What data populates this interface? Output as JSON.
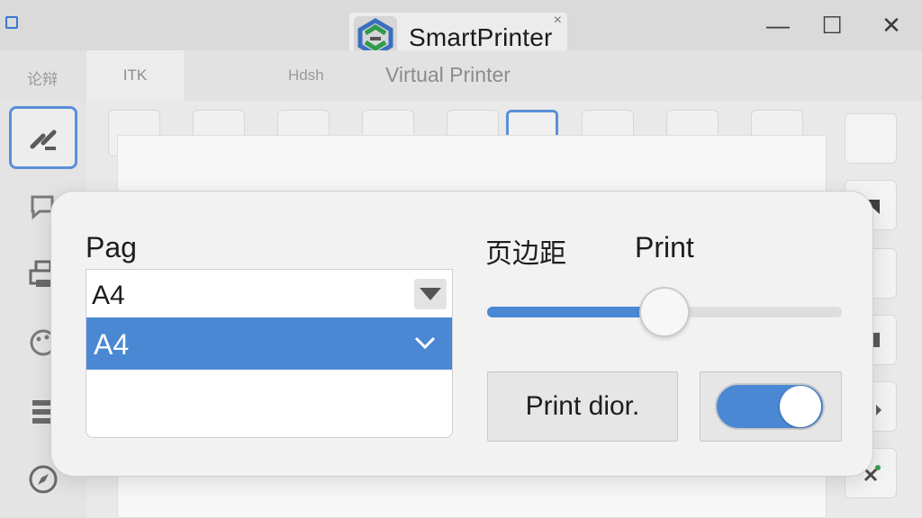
{
  "window": {
    "title": "SmartPrinter",
    "minimize_glyph": "—",
    "maximize_glyph": "☐",
    "close_glyph": "✕",
    "title_close_glyph": "×"
  },
  "tabs": [
    {
      "label": "论辩"
    },
    {
      "label": "ITK"
    },
    {
      "label": "Hdsh"
    },
    {
      "label": "Virtual Printer"
    }
  ],
  "left_toolbar": {
    "items": [
      {
        "icon": "brush-icon"
      },
      {
        "icon": "chat-icon"
      },
      {
        "icon": "printer-icon"
      },
      {
        "icon": "palette-icon"
      },
      {
        "icon": "stack-icon"
      },
      {
        "icon": "compass-icon"
      }
    ]
  },
  "right_toolbar": {
    "items": [
      {
        "icon": "blank-icon"
      },
      {
        "icon": "fill-icon"
      },
      {
        "icon": "blank-icon"
      },
      {
        "icon": "marker-icon"
      },
      {
        "icon": "arrow-icon"
      },
      {
        "icon": "tools-icon"
      }
    ]
  },
  "dialog": {
    "page_label": "Pag",
    "page_selected": "A4",
    "page_options": [
      "A4"
    ],
    "margin_label": "页边距",
    "print_label": "Print",
    "slider_value_pct": 50,
    "print_dialog_button": "Print dior.",
    "toggle_on": true
  },
  "colors": {
    "accent": "#4a88d4",
    "panel": "#f2f2f2"
  }
}
